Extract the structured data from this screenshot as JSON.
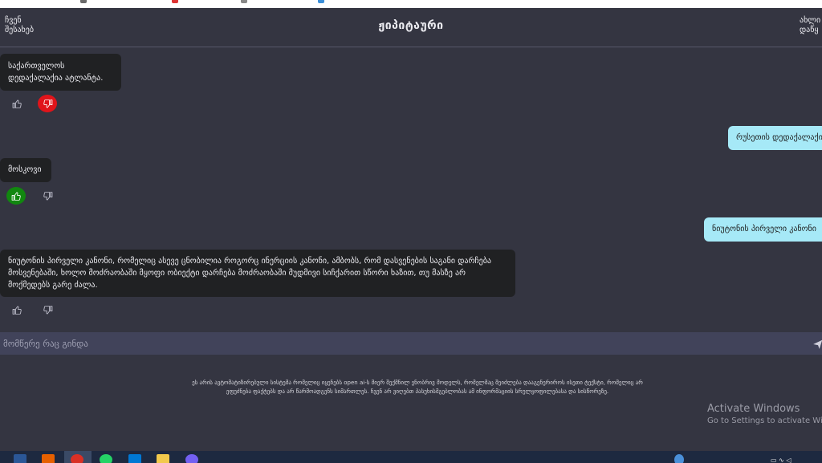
{
  "header": {
    "left_link_line1": "ჩვენ",
    "left_link_line2": "შესახებ",
    "title": "ჟიპიტაური",
    "right_link_line1": "ახლი",
    "right_link_line2": "დაწყ"
  },
  "messages": [
    {
      "role": "bot",
      "text": "საქართველოს დედაქალაქია ატლანტა.",
      "feedback": "dislike"
    },
    {
      "role": "user",
      "text": "რუსეთის დედაქალაქი"
    },
    {
      "role": "bot",
      "text": "მოსკოვი",
      "feedback": "like"
    },
    {
      "role": "user",
      "text": "ნიუტონის პირველი კანონი"
    },
    {
      "role": "bot",
      "text": "ნიუტონის პირველი კანონი, რომელიც ასევე ცნობილია როგორც ინერციის კანონი, ამბობს, რომ დასვენების საგანი დარჩება მოსვენებაში, ხოლო მოძრაობაში მყოფი ობიექტი დარჩება მოძრაობაში მუდმივი სიჩქარით სწორი ხაზით, თუ მასზე არ მოქმედებს გარე ძალა.",
      "feedback": "none"
    }
  ],
  "input": {
    "placeholder": "მომწერე რაც გინდა"
  },
  "disclaimer": "ეს არის ავტომატიზირებული სისტემა რომელიც იყენებს open ai-ს მიერ შექმნილ ენობრივ მოდელს, რომელმაც შეიძლება დააგენერიროს ისეთი ტექსტი, რომელიც არ ეფუძნება ფაქტებს და არ წარმოადგენს სიმართლეს. ჩვენ არ ვიღებთ პასუხისმგებლობას ამ ინფორმაციის სრულყოფილებასა და სისწორეზე.",
  "watermark": {
    "title": "Activate Windows",
    "subtitle": "Go to Settings to activate Win"
  },
  "colors": {
    "dislike_active": "#e0141a",
    "like_active": "#11870f",
    "user_bubble": "#a6e9f7",
    "bot_bubble": "#202123"
  }
}
